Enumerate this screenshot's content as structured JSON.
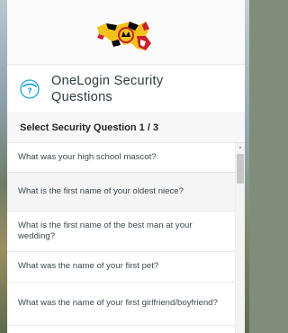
{
  "header": {
    "title": "OneLogin Security Questions"
  },
  "subheader": {
    "label": "Select Security Question 1 / 3"
  },
  "questions": [
    "What was your high school mascot?",
    "What is the first name of your oldest niece?",
    "What is the first name of the best man at your wedding?",
    "What was the name of your first pet?",
    "What was the name of your first girlfriend/boyfriend?"
  ],
  "icons": {
    "logo": "maryland-flag-logo",
    "header": "help-question-icon",
    "scroll_up": "chevron-up-icon"
  },
  "colors": {
    "accent": "#1aa3d4",
    "flag_yellow": "#f2c21b",
    "flag_red": "#c8202f",
    "flag_black": "#000000"
  }
}
